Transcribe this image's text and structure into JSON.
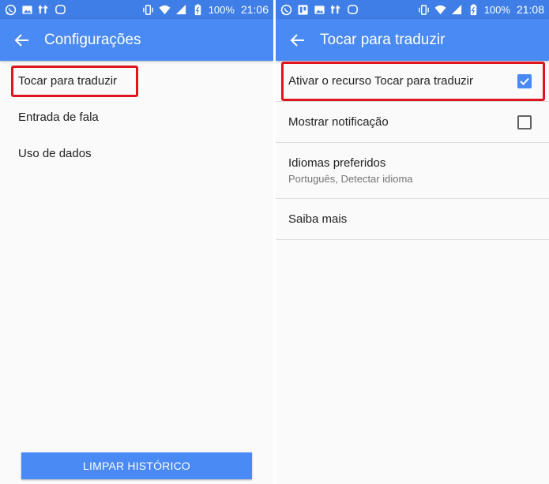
{
  "colors": {
    "status_bar": "#3f7ee6",
    "app_bar": "#4a8af4",
    "highlight": "#e0141e",
    "background": "#fafafa"
  },
  "left_screen": {
    "status": {
      "notification_icons": [
        "whatsapp-icon",
        "image-icon",
        "tt-icon",
        "chat-bubble-icon"
      ],
      "system_icons": [
        "vibrate-icon",
        "wifi-icon",
        "signal-icon",
        "battery-icon"
      ],
      "battery": "100%",
      "time": "21:06"
    },
    "title": "Configurações",
    "items": [
      "Tocar para traduzir",
      "Entrada de fala",
      "Uso de dados"
    ],
    "button": "LIMPAR HISTÓRICO"
  },
  "right_screen": {
    "status": {
      "notification_icons": [
        "whatsapp-icon",
        "trello-icon",
        "image-icon",
        "tt-icon",
        "chat-bubble-icon"
      ],
      "system_icons": [
        "vibrate-icon",
        "wifi-icon",
        "signal-icon",
        "battery-icon"
      ],
      "battery": "100%",
      "time": "21:08"
    },
    "title": "Tocar para traduzir",
    "items": [
      {
        "label": "Ativar o recurso Tocar para traduzir",
        "checked": true
      },
      {
        "label": "Mostrar notificação",
        "checked": false
      },
      {
        "label": "Idiomas preferidos",
        "summary": "Português, Detectar idioma"
      },
      {
        "label": "Saiba mais"
      }
    ]
  }
}
